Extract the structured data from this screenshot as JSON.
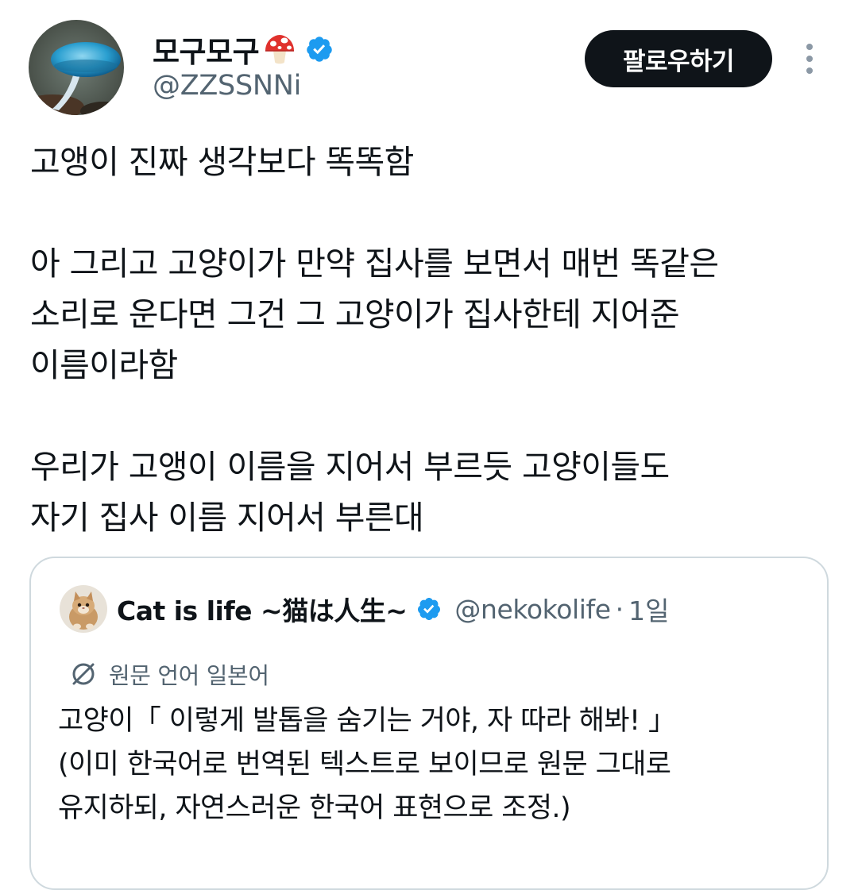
{
  "author": {
    "display_name": "모구모구",
    "handle": "@ZZSSNNi",
    "avatar_icon": "mushroom-photo-avatar",
    "name_emoji": "mushroom-icon",
    "verified_icon": "verified-badge-icon"
  },
  "actions": {
    "follow_label": "팔로우하기",
    "more_icon": "more-vertical-icon"
  },
  "tweet": {
    "lines": [
      "고앵이 진짜 생각보다 똑똑함",
      "",
      "아 그리고 고양이가 만약 집사를 보면서 매번 똑같은",
      "소리로 운다면 그건 그 고양이가 집사한테 지어준",
      "이름이라함",
      "",
      "우리가 고앵이 이름을 지어서 부르듯 고양이들도",
      "자기 집사 이름 지어서 부른대"
    ]
  },
  "quote": {
    "display_name": "Cat is life ~猫は人生~",
    "handle": "@nekokolife",
    "separator": "·",
    "time": "1일",
    "translate_label": "원문 언어 일본어",
    "lines": [
      "고양이「 이렇게 발톱을 숨기는 거야, 자 따라 해봐! 」",
      "(이미 한국어로 번역된 텍스트로 보이므로 원문 그대로",
      "유지하되, 자연스러운 한국어 표현으로 조정.)"
    ]
  },
  "colors": {
    "text_primary": "#0f1419",
    "text_secondary": "#536471",
    "verified_blue": "#1d9bf0",
    "button_bg": "#0f1419",
    "border": "#cfd9de"
  }
}
